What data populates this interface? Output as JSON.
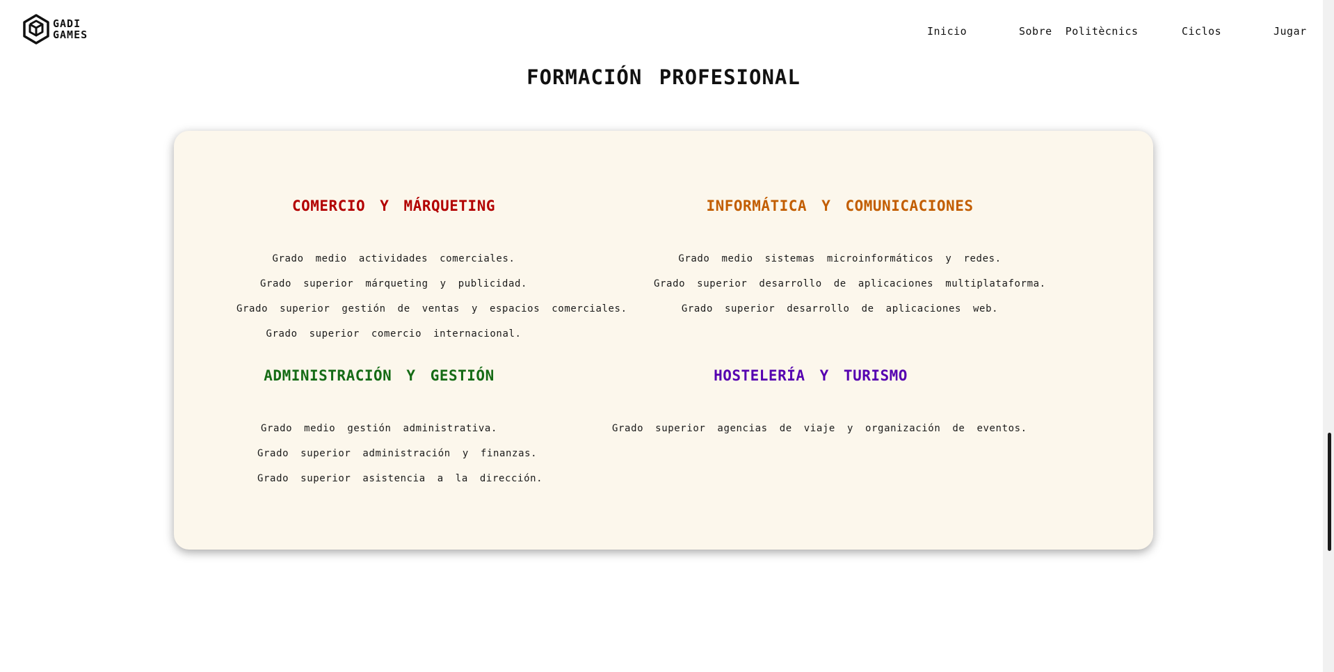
{
  "header": {
    "logo": {
      "line1": "GADI",
      "line2": "GAMES"
    },
    "nav": [
      {
        "label": "Inicio"
      },
      {
        "label": "Sobre  Politècnics"
      },
      {
        "label": "Ciclos"
      },
      {
        "label": "Jugar"
      }
    ]
  },
  "main": {
    "title": "FORMACIÓN PROFESIONAL",
    "sections": [
      {
        "title": "COMERCIO Y MÁRQUETING",
        "color": "#b20000",
        "courses": [
          "Grado medio actividades comerciales.",
          "Grado superior márqueting y publicidad.",
          "Grado superior gestión de ventas y espacios comerciales.",
          "Grado superior comercio internacional."
        ]
      },
      {
        "title": "INFORMÁTICA Y COMUNICACIONES",
        "color": "#c25d00",
        "courses": [
          "Grado medio sistemas microinformáticos y redes.",
          "Grado superior desarrollo de aplicaciones multiplataforma.",
          "Grado superior desarrollo de aplicaciones web."
        ]
      },
      {
        "title": "ADMINISTRACIÓN Y GESTIÓN",
        "color": "#156b15",
        "courses": [
          "Grado medio gestión administrativa.",
          "Grado superior administración y finanzas.",
          "Grado superior asistencia a la dirección."
        ]
      },
      {
        "title": "HOSTELERÍA Y TURISMO",
        "color": "#5500b0",
        "courses": [
          "Grado superior agencias de viaje y organización de eventos."
        ]
      }
    ]
  },
  "icons": {
    "logo": "hexagon-cube-logo-icon"
  }
}
